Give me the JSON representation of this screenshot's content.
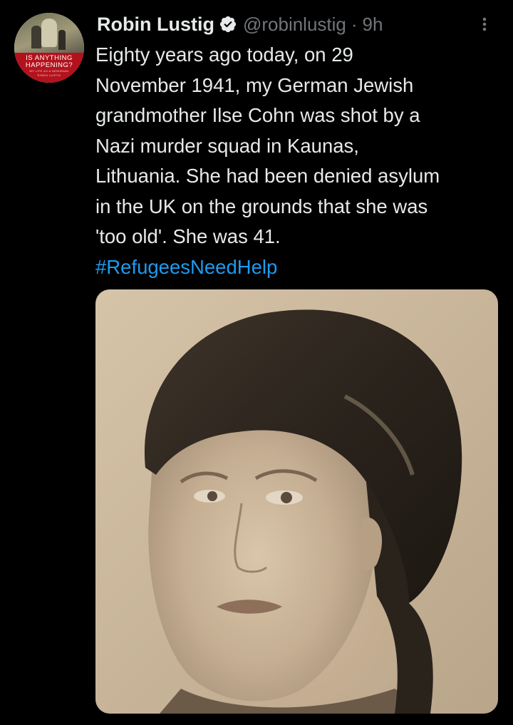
{
  "tweet": {
    "author": {
      "display_name": "Robin Lustig",
      "handle": "@robinlustig",
      "verified_icon": "verified-badge-icon",
      "avatar": {
        "line1": "IS ANYTHING",
        "line2": "HAPPENING?",
        "line3": "MY LIFE AS A NEWSMAN",
        "line4": "ROBIN LUSTIG"
      }
    },
    "separator": "·",
    "time": "9h",
    "text": "Eighty years ago today, on 29\nNovember 1941, my German Jewish\ngrandmother Ilse Cohn was shot by a\nNazi murder squad in Kaunas,\nLithuania. She had been denied asylum\nin the UK on the grounds that she was\n'too old'. She was 41.",
    "hashtag": "#RefugeesNeedHelp",
    "media": {
      "type": "photo",
      "description_icon": "sepia-portrait-photo"
    }
  },
  "colors": {
    "background": "#000000",
    "text_primary": "#e7e9ea",
    "text_secondary": "#71767b",
    "link": "#1d9bf0",
    "verified_badge": "#e7e9ea",
    "avatar_band": "#b3121d"
  },
  "icons": {
    "more": "more-vertical-icon",
    "verified": "verified-badge-icon"
  }
}
